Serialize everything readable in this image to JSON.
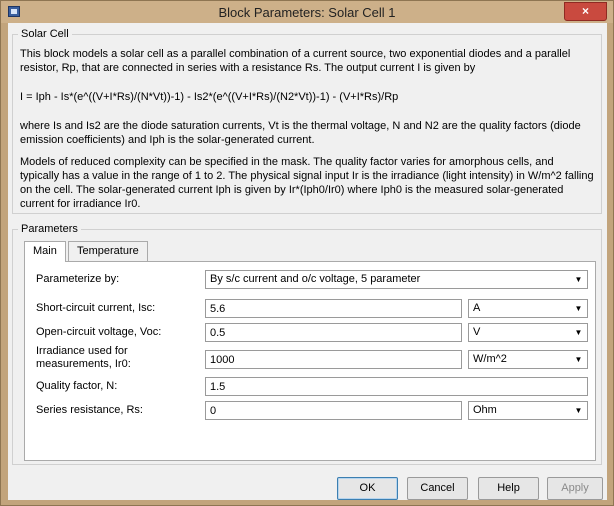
{
  "window": {
    "title": "Block Parameters: Solar Cell 1",
    "close": "×"
  },
  "block_group": {
    "legend": "Solar Cell",
    "p1": "This block models a solar cell as a parallel combination of a current source, two exponential diodes and a parallel resistor, Rp, that are connected in series with a resistance Rs. The output current I is given by",
    "equation": "I = Iph - Is*(e^((V+I*Rs)/(N*Vt))-1) - Is2*(e^((V+I*Rs)/(N2*Vt))-1) - (V+I*Rs)/Rp",
    "p2": "where Is and Is2 are the diode saturation currents, Vt is the thermal voltage, N and N2 are the quality factors (diode emission coefficients) and Iph is the solar-generated current.",
    "p3": "Models of reduced complexity can be specified in the mask. The quality factor varies for amorphous cells, and typically has a value in the range of 1 to 2. The physical signal input Ir is the irradiance (light intensity) in W/m^2 falling on the cell. The solar-generated current Iph is given by Ir*(Iph0/Ir0) where Iph0 is the measured solar-generated current for irradiance Ir0."
  },
  "params_group": {
    "legend": "Parameters",
    "tabs": [
      {
        "label": "Main"
      },
      {
        "label": "Temperature"
      }
    ],
    "rows": [
      {
        "label": "Parameterize by:",
        "value": "By s/c current and o/c voltage, 5 parameter"
      },
      {
        "label": "Short-circuit current, Isc:",
        "value": "5.6",
        "unit": "A"
      },
      {
        "label": "Open-circuit voltage, Voc:",
        "value": "0.5",
        "unit": "V"
      },
      {
        "label_line1": "Irradiance used for",
        "label_line2": "measurements, Ir0:",
        "value": "1000",
        "unit": "W/m^2"
      },
      {
        "label": "Quality factor, N:",
        "value": "1.5"
      },
      {
        "label": "Series resistance, Rs:",
        "value": "0",
        "unit": "Ohm"
      }
    ]
  },
  "buttons": {
    "ok": "OK",
    "cancel": "Cancel",
    "help": "Help",
    "apply": "Apply"
  },
  "colors": {
    "frame": "#c2a47c",
    "close": "#c94a3f",
    "dialog_bg": "#f0f0f0"
  },
  "icons": {
    "app": "simulink-block-icon",
    "dropdown": "chevron-down-icon"
  }
}
